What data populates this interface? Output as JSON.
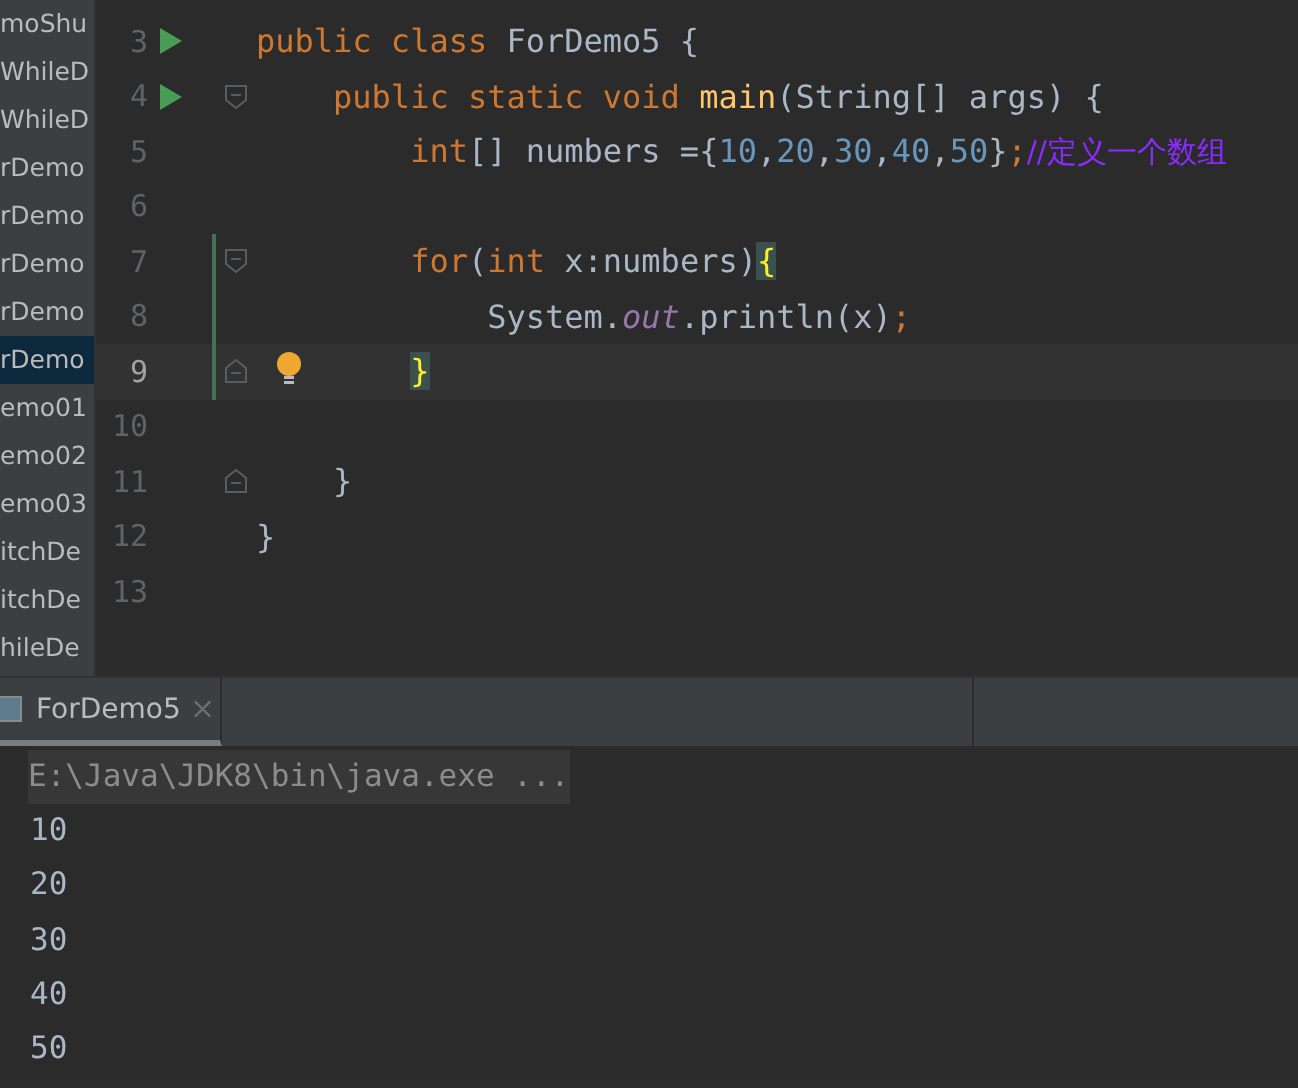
{
  "project_tree": {
    "items": [
      {
        "label": "moShu",
        "selected": false
      },
      {
        "label": "WhileD",
        "selected": false
      },
      {
        "label": "WhileD",
        "selected": false
      },
      {
        "label": "rDemo",
        "selected": false
      },
      {
        "label": "rDemo",
        "selected": false
      },
      {
        "label": "rDemo",
        "selected": false
      },
      {
        "label": "rDemo",
        "selected": false
      },
      {
        "label": "rDemo",
        "selected": true
      },
      {
        "label": "emo01",
        "selected": false
      },
      {
        "label": "emo02",
        "selected": false
      },
      {
        "label": "emo03",
        "selected": false
      },
      {
        "label": "itchDe",
        "selected": false
      },
      {
        "label": "itchDe",
        "selected": false
      },
      {
        "label": "hileDe",
        "selected": false
      }
    ]
  },
  "editor": {
    "lines": [
      {
        "number": "3",
        "run": true,
        "fold_start": false,
        "fold_end": false,
        "current": false,
        "modified": false,
        "tokens": [
          {
            "kind": "keyword",
            "text": "public class "
          },
          {
            "kind": "plain",
            "text": "ForDemo5 {"
          }
        ]
      },
      {
        "number": "4",
        "run": true,
        "fold_start": true,
        "fold_end": false,
        "current": false,
        "modified": false,
        "tokens": [
          {
            "kind": "keyword",
            "text": "    public static void "
          },
          {
            "kind": "method",
            "text": "main"
          },
          {
            "kind": "plain",
            "text": "(String[] args) {"
          }
        ]
      },
      {
        "number": "5",
        "run": false,
        "fold_start": false,
        "fold_end": false,
        "current": false,
        "modified": false,
        "tokens": [
          {
            "kind": "keyword",
            "text": "        int"
          },
          {
            "kind": "plain",
            "text": "[] numbers ={"
          },
          {
            "kind": "number",
            "text": "10"
          },
          {
            "kind": "plain",
            "text": ","
          },
          {
            "kind": "number",
            "text": "20"
          },
          {
            "kind": "plain",
            "text": ","
          },
          {
            "kind": "number",
            "text": "30"
          },
          {
            "kind": "plain",
            "text": ","
          },
          {
            "kind": "number",
            "text": "40"
          },
          {
            "kind": "plain",
            "text": ","
          },
          {
            "kind": "number",
            "text": "50"
          },
          {
            "kind": "plain",
            "text": "}"
          },
          {
            "kind": "keyword",
            "text": ";"
          },
          {
            "kind": "comment",
            "text": "//定义一个数组"
          }
        ]
      },
      {
        "number": "6",
        "run": false,
        "fold_start": false,
        "fold_end": false,
        "current": false,
        "modified": false
      },
      {
        "number": "7",
        "run": false,
        "fold_start": true,
        "fold_end": false,
        "current": false,
        "modified": true,
        "tokens": [
          {
            "kind": "keyword",
            "text": "        for"
          },
          {
            "kind": "plain",
            "text": "("
          },
          {
            "kind": "keyword",
            "text": "int "
          },
          {
            "kind": "plain",
            "text": "x:numbers)"
          },
          {
            "kind": "brace",
            "text": "{"
          }
        ]
      },
      {
        "number": "8",
        "run": false,
        "fold_start": false,
        "fold_end": false,
        "current": false,
        "modified": true,
        "tokens": [
          {
            "kind": "plain",
            "text": "            System."
          },
          {
            "kind": "field",
            "text": "out"
          },
          {
            "kind": "plain",
            "text": ".println(x)"
          },
          {
            "kind": "keyword",
            "text": ";"
          }
        ]
      },
      {
        "number": "9",
        "run": false,
        "fold_start": false,
        "fold_end": true,
        "current": true,
        "modified": true,
        "tokens": [
          {
            "kind": "brace",
            "text": "        }"
          }
        ]
      },
      {
        "number": "10",
        "run": false,
        "fold_start": false,
        "fold_end": false,
        "current": false,
        "modified": false
      },
      {
        "number": "11",
        "run": false,
        "fold_start": false,
        "fold_end": true,
        "current": false,
        "modified": false,
        "tokens": [
          {
            "kind": "plain",
            "text": "    }"
          }
        ]
      },
      {
        "number": "12",
        "run": false,
        "fold_start": false,
        "fold_end": false,
        "current": false,
        "modified": false,
        "tokens": [
          {
            "kind": "plain",
            "text": "}"
          }
        ]
      },
      {
        "number": "13",
        "run": false,
        "fold_start": false,
        "fold_end": false,
        "current": false,
        "modified": false
      }
    ]
  },
  "run_panel": {
    "tabs": [
      {
        "label": "ForDemo5",
        "selected": true
      }
    ],
    "command": "E:\\Java\\JDK8\\bin\\java.exe ...",
    "output": [
      "10",
      "20",
      "30",
      "40",
      "50"
    ]
  }
}
